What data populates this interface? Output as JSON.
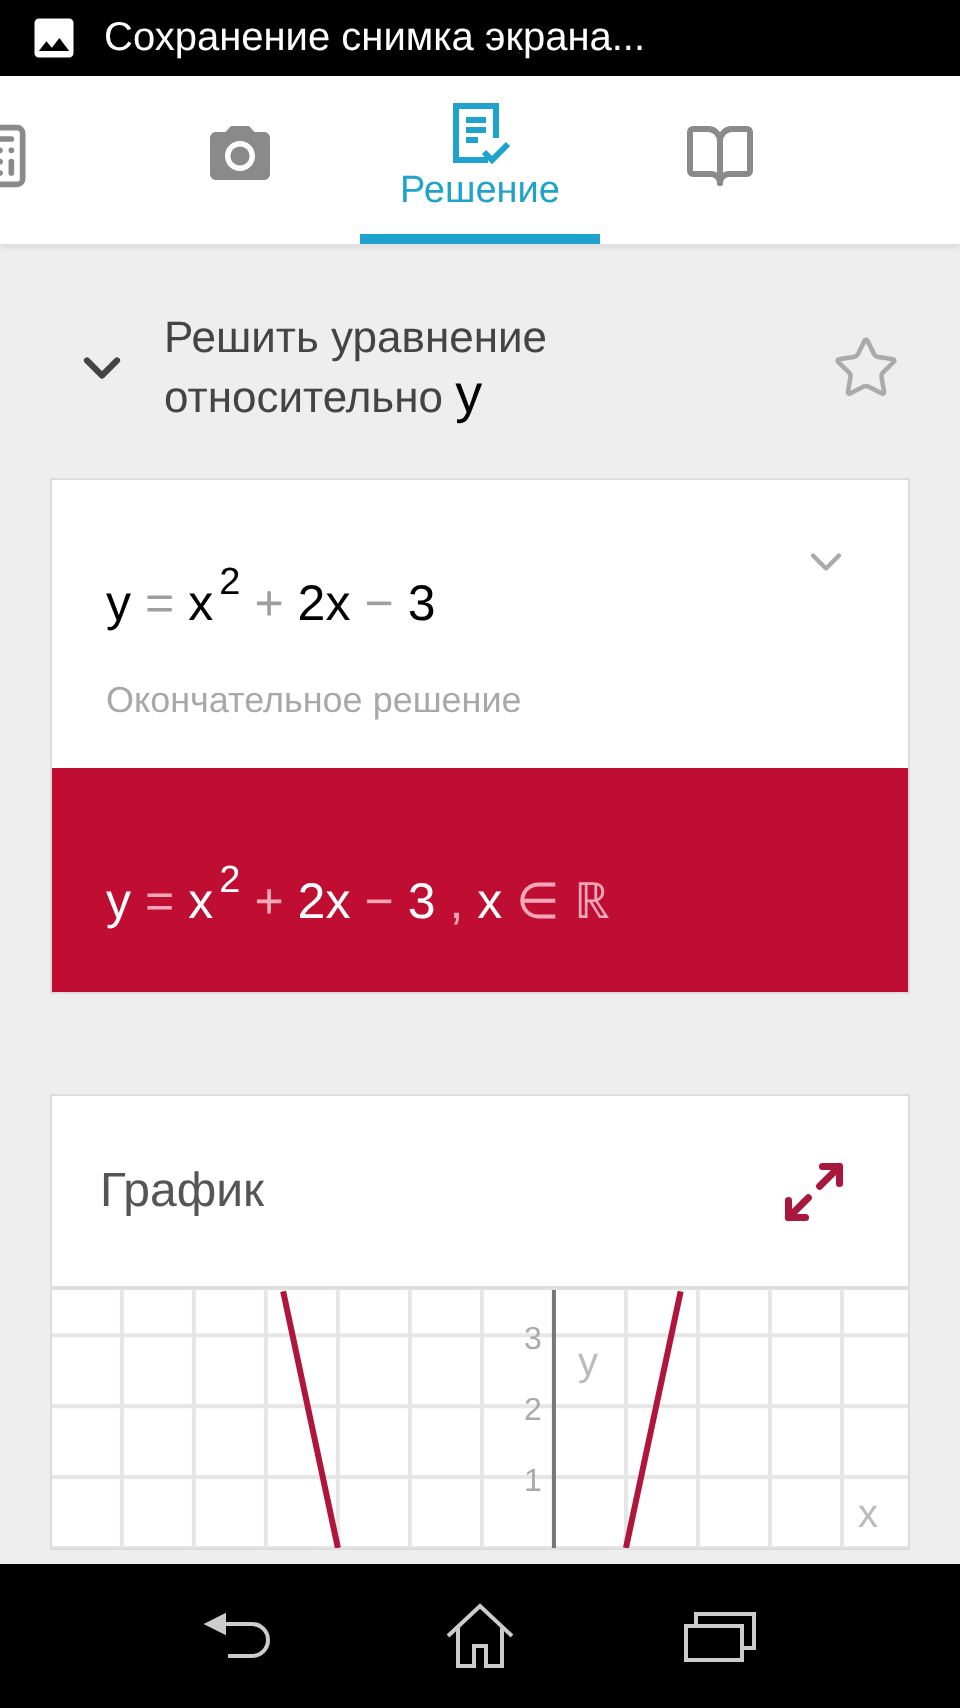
{
  "status_bar": {
    "notification": "Сохранение снимка экрана..."
  },
  "tabs": [
    {
      "kind": "calculator",
      "selected": false
    },
    {
      "kind": "camera",
      "selected": false
    },
    {
      "kind": "solution",
      "label": "Решение",
      "selected": true
    },
    {
      "kind": "book",
      "selected": false
    }
  ],
  "problem": {
    "title": "Решить уравнение относительно",
    "variable": "y",
    "expanded": true,
    "favorite": false
  },
  "solution_card": {
    "equation": [
      {
        "t": "y",
        "kind": "var"
      },
      {
        "t": "=",
        "kind": "op"
      },
      {
        "t": "x",
        "kind": "var"
      },
      {
        "t": "2",
        "kind": "sup"
      },
      {
        "t": "+",
        "kind": "op"
      },
      {
        "t": "2x",
        "kind": "var"
      },
      {
        "t": "−",
        "kind": "op"
      },
      {
        "t": "3",
        "kind": "var"
      }
    ],
    "caption": "Окончательное решение",
    "answer": [
      {
        "t": "y",
        "kind": "var"
      },
      {
        "t": "=",
        "kind": "op"
      },
      {
        "t": "x",
        "kind": "var"
      },
      {
        "t": "2",
        "kind": "sup"
      },
      {
        "t": "+",
        "kind": "op"
      },
      {
        "t": "2x",
        "kind": "var"
      },
      {
        "t": "−",
        "kind": "op"
      },
      {
        "t": "3",
        "kind": "var"
      },
      {
        "t": ",",
        "kind": "op"
      },
      {
        "t": "x",
        "kind": "var"
      },
      {
        "t": "∈",
        "kind": "op"
      },
      {
        "t": "ℝ",
        "kind": "op"
      }
    ]
  },
  "graph_card": {
    "title": "График",
    "plot": {
      "y_axis_label": "y",
      "x_axis_label": "x",
      "y_tick_labels": [
        "3",
        "2",
        "1"
      ]
    }
  }
}
